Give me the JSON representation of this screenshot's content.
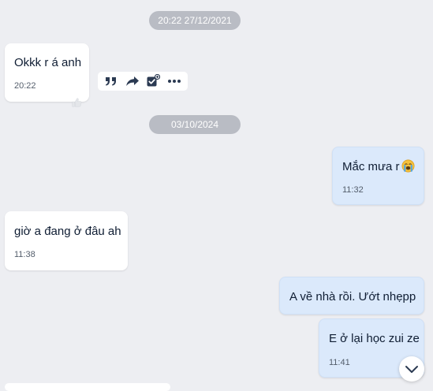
{
  "dates": {
    "first": "20:22 27/12/2021",
    "second": "03/10/2024"
  },
  "messages": [
    {
      "direction": "incoming",
      "text": "Okkk r á anh",
      "time": "20:22"
    },
    {
      "direction": "outgoing",
      "text": "Mắc mưa r",
      "emoji": "crying-face",
      "time": "11:32"
    },
    {
      "direction": "incoming",
      "text": "giờ a đang ở đâu ah",
      "time": "11:38"
    },
    {
      "direction": "outgoing",
      "text": "A về nhà rồi. Ướt nhẹpp",
      "time": ""
    },
    {
      "direction": "outgoing",
      "text": "E ở lại học zui ze",
      "time": "11:41"
    }
  ],
  "toolbar": {
    "icons": [
      "quote-icon",
      "forward-icon",
      "add-task-icon",
      "more-icon"
    ]
  },
  "icons": {
    "react": "thumbs-up-icon",
    "scroll": "chevron-down-icon"
  },
  "colors": {
    "background": "#edeef2",
    "incoming_bubble": "#ffffff",
    "outgoing_bubble": "#dbe9fb",
    "date_pill": "#b9bcc4",
    "icon": "#2b3a52",
    "emoji": "#f5c13a"
  }
}
